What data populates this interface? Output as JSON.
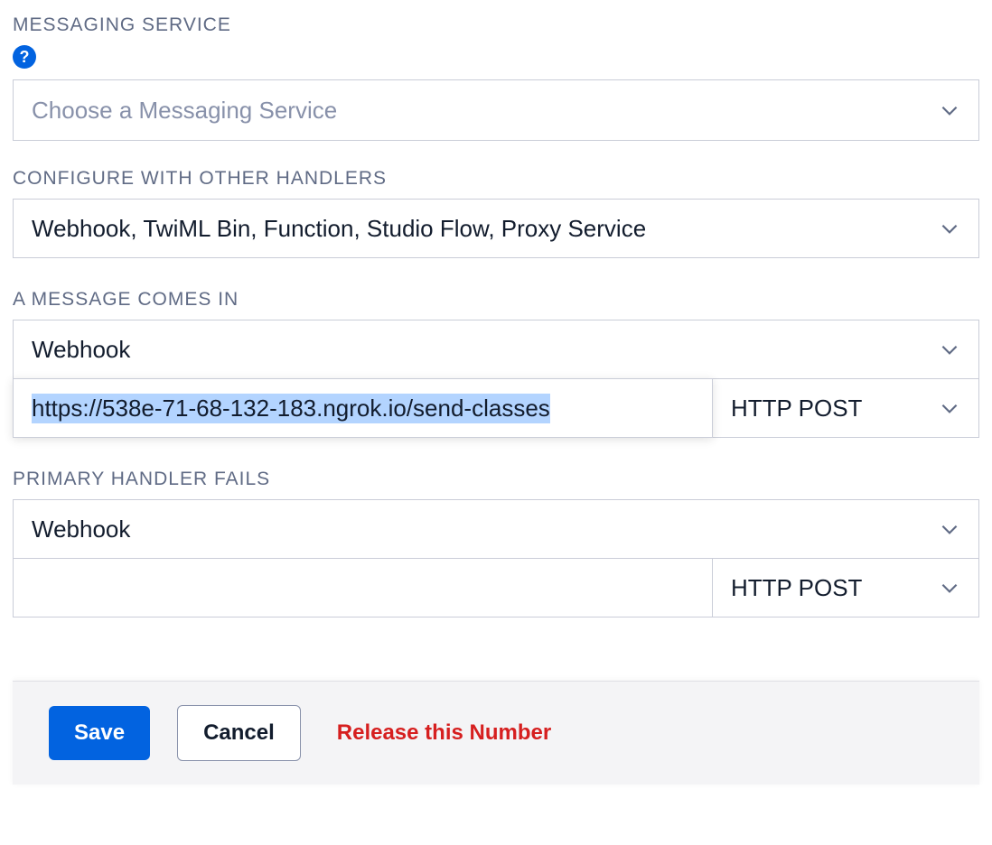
{
  "messaging_service": {
    "label": "MESSAGING SERVICE",
    "placeholder": "Choose a Messaging Service"
  },
  "configure_handlers": {
    "label": "CONFIGURE WITH OTHER HANDLERS",
    "value": "Webhook, TwiML Bin, Function, Studio Flow, Proxy Service"
  },
  "message_comes_in": {
    "label": "A MESSAGE COMES IN",
    "handler": "Webhook",
    "url": "https://538e-71-68-132-183.ngrok.io/send-classes",
    "method": "HTTP POST"
  },
  "primary_handler_fails": {
    "label": "PRIMARY HANDLER FAILS",
    "handler": "Webhook",
    "url": "",
    "method": "HTTP POST"
  },
  "footer": {
    "save": "Save",
    "cancel": "Cancel",
    "release": "Release this Number"
  },
  "icons": {
    "help_glyph": "?"
  }
}
